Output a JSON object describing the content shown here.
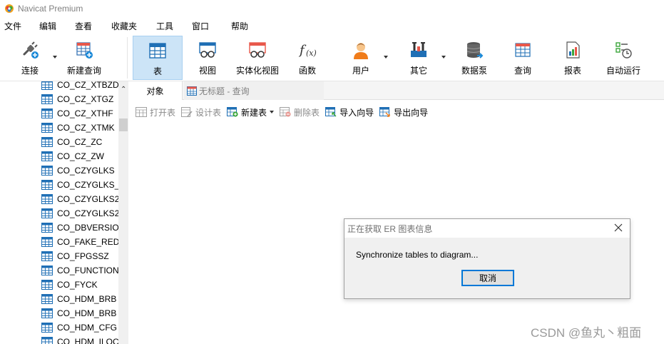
{
  "window": {
    "title": "Navicat Premium"
  },
  "menu": [
    "文件",
    "编辑",
    "查看",
    "收藏夹",
    "工具",
    "窗口",
    "帮助"
  ],
  "toolbar": {
    "connect": "连接",
    "new_query": "新建查询",
    "table": "表",
    "view": "视图",
    "materialized_view": "实体化视图",
    "function": "函数",
    "user": "用户",
    "other": "其它",
    "data_pump": "数据泵",
    "query": "查询",
    "report": "报表",
    "auto_run": "自动运行"
  },
  "tree": {
    "items": [
      "CO_CZ_XTBZD",
      "CO_CZ_XTGZ",
      "CO_CZ_XTHF",
      "CO_CZ_XTMK",
      "CO_CZ_ZC",
      "CO_CZ_ZW",
      "CO_CZYGLKS",
      "CO_CZYGLKS_I",
      "CO_CZYGLKS2",
      "CO_CZYGLKS2",
      "CO_DBVERSIO",
      "CO_FAKE_RED",
      "CO_FPGSSZ",
      "CO_FUNCTION",
      "CO_FYCK",
      "CO_HDM_BRB",
      "CO_HDM_BRB",
      "CO_HDM_CFG",
      "CO_HDM_ILOC"
    ]
  },
  "tabs": {
    "objects": "对象",
    "query": "无标题 - 查询"
  },
  "object_toolbar": {
    "open_table": "打开表",
    "design_table": "设计表",
    "new_table": "新建表",
    "delete_table": "删除表",
    "import_wizard": "导入向导",
    "export_wizard": "导出向导"
  },
  "dialog": {
    "title": "正在获取 ER 图表信息",
    "message": "Synchronize tables to diagram...",
    "cancel": "取消"
  },
  "watermark": "CSDN @鱼丸丶粗面",
  "colors": {
    "accent": "#0078d7",
    "active_tab_bg": "#cce4f7",
    "table_icon": "#1f6fb5"
  }
}
